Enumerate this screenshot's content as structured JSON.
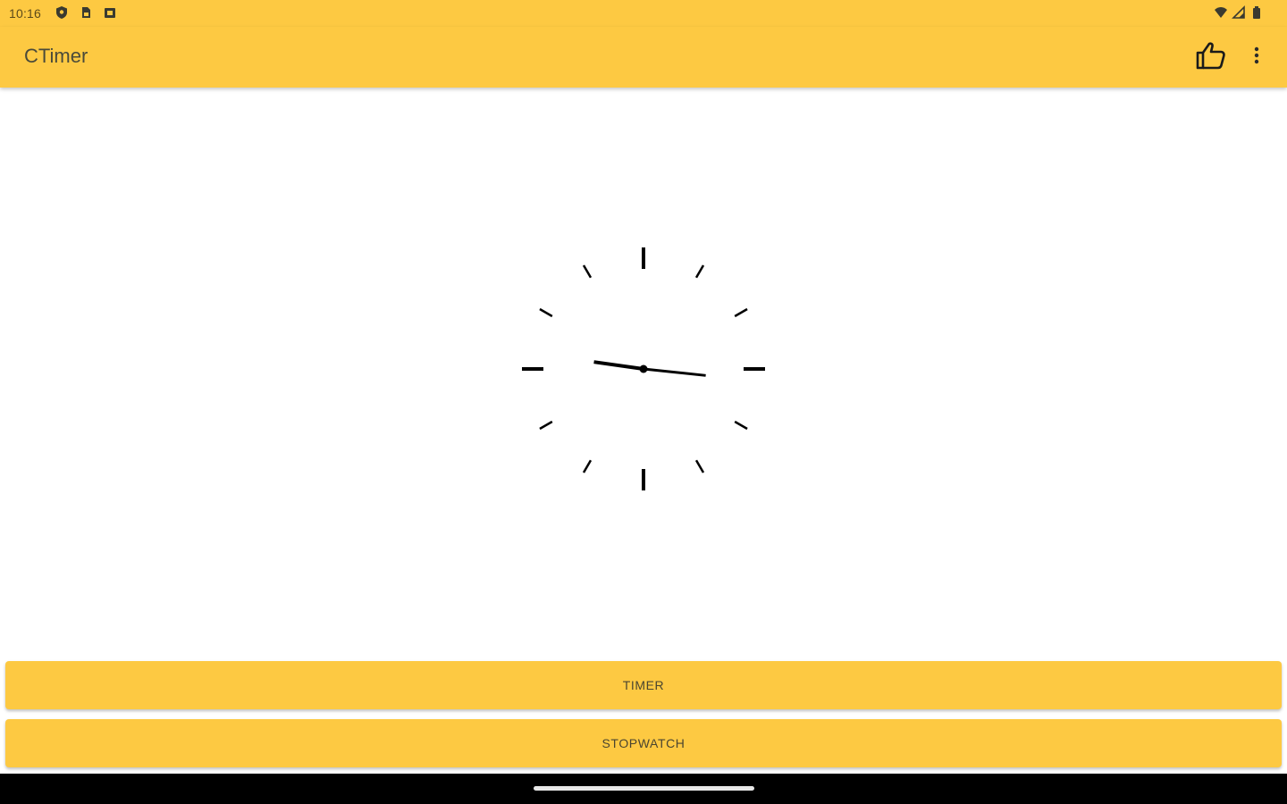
{
  "status_bar": {
    "time": "10:16",
    "left_icons": [
      "shield-icon",
      "sim-card-icon",
      "notification-icon"
    ],
    "right_icons": [
      "wifi-icon",
      "cell-signal-icon",
      "battery-icon"
    ]
  },
  "app_bar": {
    "title": "CTimer",
    "actions": [
      "thumbs-up-icon",
      "more-vert-icon"
    ]
  },
  "clock": {
    "hour": 9,
    "minute": 16
  },
  "buttons": {
    "timer_label": "TIMER",
    "stopwatch_label": "STOPWATCH"
  },
  "colors": {
    "accent": "#fdc942",
    "background": "#ffffff",
    "nav_bar": "#000000"
  }
}
